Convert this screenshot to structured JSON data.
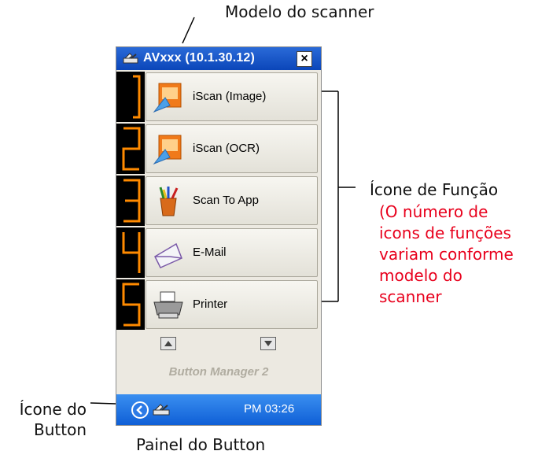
{
  "annotations": {
    "scanner_model": "Modelo do scanner",
    "function_icon": "Ícone de Função",
    "function_note": [
      "(O número de",
      "icons de funções",
      "variam conforme",
      "modelo do",
      "scanner"
    ],
    "button_icon": [
      "Ícone do",
      "Button"
    ],
    "button_panel": "Painel do Button"
  },
  "window": {
    "title": "AVxxx  (10.1.30.12)",
    "close": "×"
  },
  "functions": [
    {
      "number": "1",
      "label": "iScan (Image)",
      "icon": "iscan-image-icon"
    },
    {
      "number": "2",
      "label": "iScan (OCR)",
      "icon": "iscan-ocr-icon"
    },
    {
      "number": "3",
      "label": "Scan To App",
      "icon": "scan-to-app-icon"
    },
    {
      "number": "4",
      "label": "E-Mail",
      "icon": "email-icon"
    },
    {
      "number": "5",
      "label": "Printer",
      "icon": "printer-icon"
    }
  ],
  "footer": {
    "product": "Button Manager 2",
    "clock": "PM 03:26"
  },
  "colors": {
    "accent_red": "#e8001c",
    "title_blue": "#0b46b9",
    "digit_orange": "#ff8a00"
  }
}
